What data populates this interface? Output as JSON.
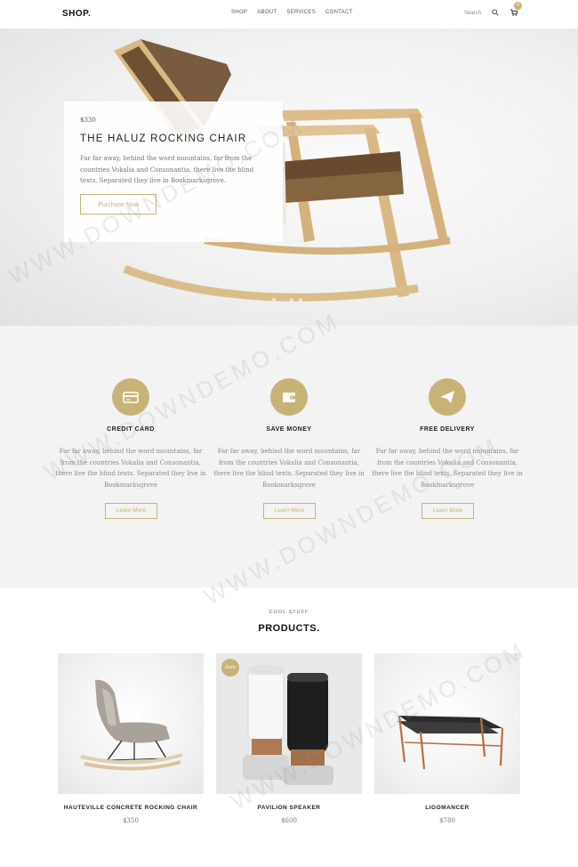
{
  "nav": {
    "brand": "SHOP.",
    "menu": [
      "SHOP",
      "ABOUT",
      "SERVICES",
      "CONTACT"
    ],
    "search_placeholder": "Search",
    "cart_count": "0"
  },
  "hero": {
    "price": "$330",
    "title": "THE HALUZ ROCKING CHAIR",
    "text": "Far far away, behind the word mountains, far from the countries Vokalia and Consonantia, there live the blind texts. Separated they live in Bookmarksgrove.",
    "button": "Purchase Now",
    "slide_count": 4,
    "active_slide": 2
  },
  "services": [
    {
      "icon": "credit-card-icon",
      "title": "CREDIT CARD",
      "text": "Far far away, behind the word mountains, far from the countries Vokalia and Consonantia, there live the blind texts. Separated they live in Bookmarksgrove",
      "button": "Learn More"
    },
    {
      "icon": "wallet-icon",
      "title": "SAVE MONEY",
      "text": "Far far away, behind the word mountains, far from the countries Vokalia and Consonantia, there live the blind texts. Separated they live in Bookmarksgrove",
      "button": "Learn More"
    },
    {
      "icon": "paper-plane-icon",
      "title": "FREE DELIVERY",
      "text": "Far far away, behind the word mountains, far from the countries Vokalia and Consonantia, there live the blind texts. Separated they live in Bookmarksgrove",
      "button": "Learn More"
    }
  ],
  "products": {
    "eyebrow": "COOL STUFF",
    "title": "PRODUCTS.",
    "items": [
      {
        "name": "HAUTEVILLE CONCRETE ROCKING CHAIR",
        "price": "$350",
        "badge": ""
      },
      {
        "name": "PAVILION SPEAKER",
        "price": "$600",
        "badge": "Sale"
      },
      {
        "name": "LIGOMANCER",
        "price": "$780",
        "badge": ""
      }
    ]
  },
  "watermark": "WWW.DOWNDEMO.COM",
  "colors": {
    "accent": "#c8b377",
    "services_bg": "#f3f3f3",
    "text_dark": "#222222"
  }
}
